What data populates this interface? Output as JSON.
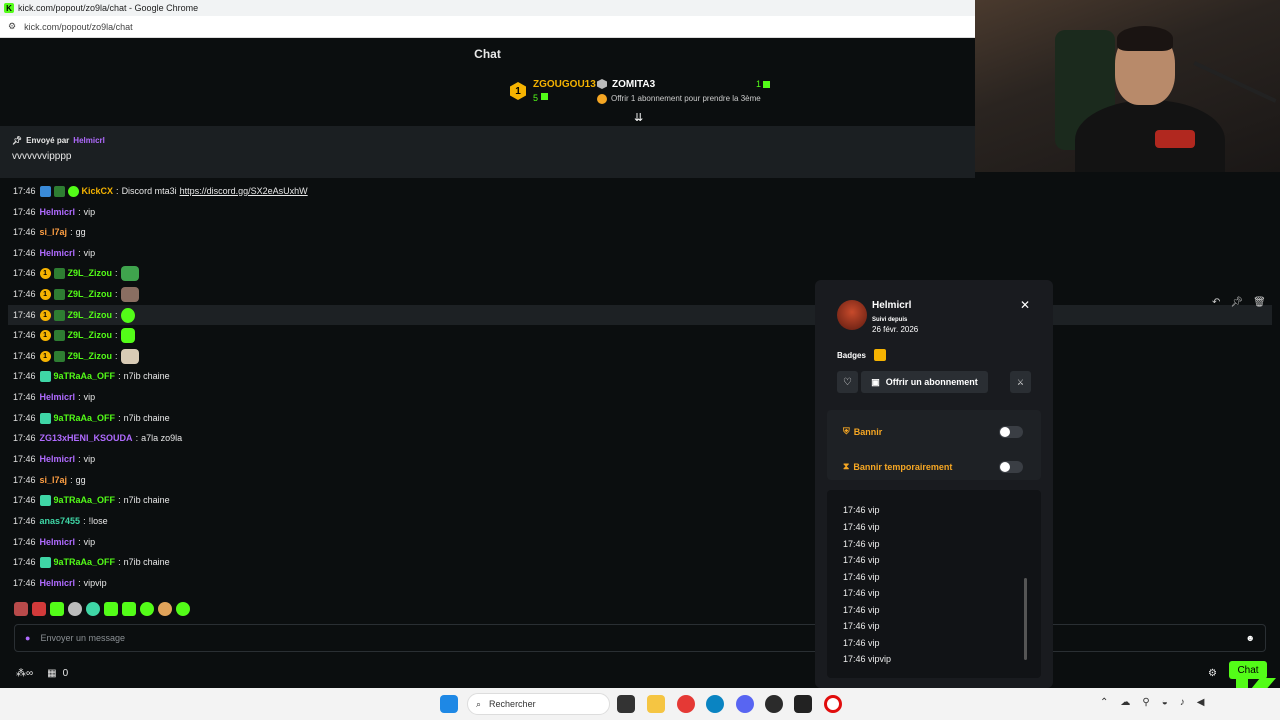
{
  "browser": {
    "window_title": "kick.com/popout/zo9la/chat - Google Chrome",
    "url": "kick.com/popout/zo9la/chat"
  },
  "header": {
    "title": "Chat"
  },
  "leaderboard": {
    "first_rank": "1",
    "first_user": "ZGOUGOU13",
    "first_count": "5",
    "second_user": "ZOMITA3",
    "second_count": "1",
    "cta": "Offrir 1 abonnement pour prendre la 3ème"
  },
  "pinned": {
    "sent_by_label": "Envoyé par",
    "sender": "Helmicrl",
    "text": "vvvvvvvipppp"
  },
  "messages": [
    {
      "time": "17:46",
      "user": "KickCX",
      "color": "#f5b301",
      "text": "Discord mta3i",
      "link": "https://discord.gg/SX2eAsUxhW"
    },
    {
      "time": "17:46",
      "user": "Helmicrl",
      "color": "#b06bff",
      "text": "vip"
    },
    {
      "time": "17:46",
      "user": "si_l7aj",
      "color": "#ff9f43",
      "text": "gg"
    },
    {
      "time": "17:46",
      "user": "Helmicrl",
      "color": "#b06bff",
      "text": "vip"
    },
    {
      "time": "17:46",
      "user": "Z9L_Zizou",
      "color": "#53fc18",
      "text": ""
    },
    {
      "time": "17:46",
      "user": "Z9L_Zizou",
      "color": "#53fc18",
      "text": ""
    },
    {
      "time": "17:46",
      "user": "Z9L_Zizou",
      "color": "#53fc18",
      "text": ""
    },
    {
      "time": "17:46",
      "user": "Z9L_Zizou",
      "color": "#53fc18",
      "text": ""
    },
    {
      "time": "17:46",
      "user": "Z9L_Zizou",
      "color": "#53fc18",
      "text": ""
    },
    {
      "time": "17:46",
      "user": "9aTRaAa_OFF",
      "color": "#53fc18",
      "text": "n7ib chaine"
    },
    {
      "time": "17:46",
      "user": "Helmicrl",
      "color": "#b06bff",
      "text": "vip"
    },
    {
      "time": "17:46",
      "user": "9aTRaAa_OFF",
      "color": "#53fc18",
      "text": "n7ib chaine"
    },
    {
      "time": "17:46",
      "user": "ZG13xHENI_KSOUDA",
      "color": "#b06bff",
      "text": "a7la zo9la"
    },
    {
      "time": "17:46",
      "user": "Helmicrl",
      "color": "#b06bff",
      "text": "vip"
    },
    {
      "time": "17:46",
      "user": "si_l7aj",
      "color": "#ff9f43",
      "text": "gg"
    },
    {
      "time": "17:46",
      "user": "9aTRaAa_OFF",
      "color": "#53fc18",
      "text": "n7ib chaine"
    },
    {
      "time": "17:46",
      "user": "anas7455",
      "color": "#3fd6a6",
      "text": "!lose"
    },
    {
      "time": "17:46",
      "user": "Helmicrl",
      "color": "#b06bff",
      "text": "vip"
    },
    {
      "time": "17:46",
      "user": "9aTRaAa_OFF",
      "color": "#53fc18",
      "text": "n7ib chaine"
    },
    {
      "time": "17:46",
      "user": "Helmicrl",
      "color": "#b06bff",
      "text": "vipvip"
    }
  ],
  "input": {
    "placeholder": "Envoyer un message"
  },
  "bottom_bar": {
    "points": "0",
    "chat_button": "Chat"
  },
  "taskbar": {
    "search_placeholder": "Rechercher"
  },
  "user_popup": {
    "username": "Helmicrl",
    "following_label": "Suivi depuis",
    "following_date": "26 févr. 2026",
    "badges_label": "Badges",
    "gift_sub_label": "Offrir un abonnement",
    "ban_label": "Bannir",
    "timeout_label": "Bannir temporairement",
    "history": [
      {
        "time": "17:46",
        "text": "vip"
      },
      {
        "time": "17:46",
        "text": "vip"
      },
      {
        "time": "17:46",
        "text": "vip"
      },
      {
        "time": "17:46",
        "text": "vip"
      },
      {
        "time": "17:46",
        "text": "vip"
      },
      {
        "time": "17:46",
        "text": "vip"
      },
      {
        "time": "17:46",
        "text": "vip"
      },
      {
        "time": "17:46",
        "text": "vip"
      },
      {
        "time": "17:46",
        "text": "vip"
      },
      {
        "time": "17:46",
        "text": "vipvip"
      }
    ]
  },
  "colors": {
    "accent": "#53fc18",
    "mod_orange": "#f5a623",
    "panel": "#191b1f"
  }
}
